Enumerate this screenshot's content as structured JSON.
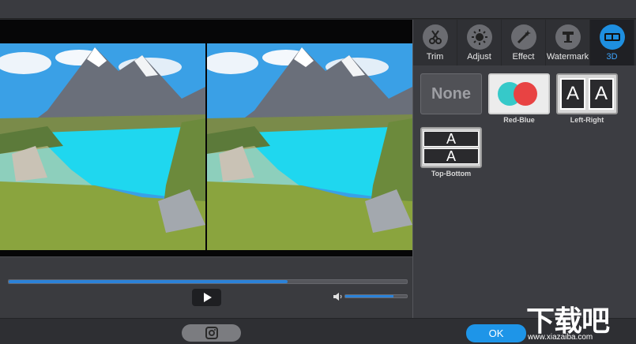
{
  "tabs": [
    {
      "label": "Trim",
      "icon": "scissors-icon"
    },
    {
      "label": "Adjust",
      "icon": "sun-icon"
    },
    {
      "label": "Effect",
      "icon": "magic-wand-icon"
    },
    {
      "label": "Watermark",
      "icon": "text-t-icon"
    },
    {
      "label": "3D",
      "icon": "glasses-3d-icon"
    }
  ],
  "active_tab": "3D",
  "modes": [
    {
      "label": "None"
    },
    {
      "label": "Red-Blue"
    },
    {
      "label": "Left-Right"
    },
    {
      "label": "Top-Bottom"
    }
  ],
  "mode_glyph": "A",
  "player": {
    "progress": 0.7,
    "volume": 0.78
  },
  "ok_label": "OK",
  "watermark": {
    "text": "下载吧",
    "url": "www.xiazaiba.com"
  },
  "colors": {
    "accent": "#1e95e8",
    "progress": "#2b82d8"
  }
}
